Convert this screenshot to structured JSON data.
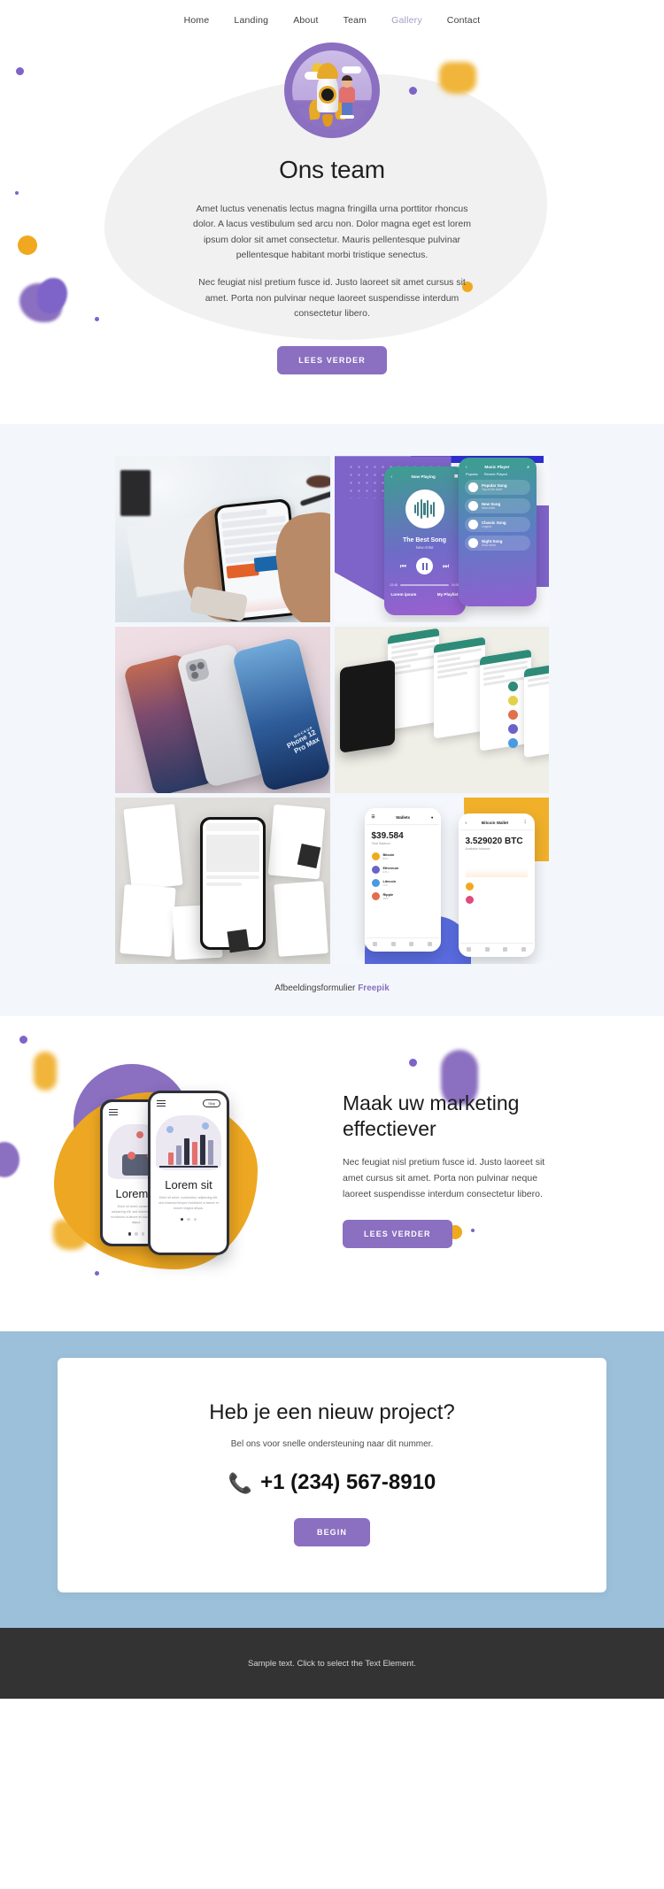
{
  "nav": {
    "items": [
      {
        "label": "Home",
        "active": false
      },
      {
        "label": "Landing",
        "active": false
      },
      {
        "label": "About",
        "active": false
      },
      {
        "label": "Team",
        "active": false
      },
      {
        "label": "Gallery",
        "active": true
      },
      {
        "label": "Contact",
        "active": false
      }
    ]
  },
  "hero": {
    "illustration_icon": "rocket-astronaut-icon",
    "title": "Ons team",
    "paragraph1": "Amet luctus venenatis lectus magna fringilla urna porttitor rhoncus dolor. A lacus vestibulum sed arcu non. Dolor magna eget est lorem ipsum dolor sit amet consectetur. Mauris pellentesque pulvinar pellentesque habitant morbi tristique senectus.",
    "paragraph2": "Nec feugiat nisl pretium fusce id. Justo laoreet sit amet cursus sit amet. Porta non pulvinar neque laoreet suspendisse interdum consectetur libero.",
    "cta_label": "LEES VERDER"
  },
  "gallery": {
    "items": [
      {
        "name": "hand-holding-phone-trading-app"
      },
      {
        "name": "music-player-app-mockup"
      },
      {
        "name": "phones-on-pink-surface"
      },
      {
        "name": "chat-app-screens-mockup"
      },
      {
        "name": "ui-screens-on-grey-desk"
      },
      {
        "name": "crypto-wallet-app-mockup"
      }
    ],
    "caption_text": "Afbeeldingsformulier",
    "caption_link": "Freepik",
    "music_mockup": {
      "now_playing": "Now Playing",
      "song_title": "The Best Song",
      "artist": "New Artist",
      "time_current": "02:48",
      "time_total": "04:09",
      "link_left": "Lorem ipsum",
      "link_right": "My Playlist",
      "player_title": "Music Player",
      "tab_popular": "Popular",
      "tab_recent": "Recent Played",
      "list": [
        {
          "title": "Popular Song",
          "sub": "Top of the chart"
        },
        {
          "title": "New Song",
          "sub": "New Artist"
        },
        {
          "title": "Classic Song",
          "sub": "Legend"
        },
        {
          "title": "Night Song",
          "sub": "Slow Artist"
        }
      ]
    },
    "pink_mockup": {
      "label_top": "MOCKUP",
      "label_model": "Phone 12",
      "label_variant": "Pro Max"
    },
    "wallet_mockup": {
      "left_title": "Wallets",
      "left_amount": "$39.584",
      "left_caption": "Total Balance",
      "right_title": "Bitcoin Wallet",
      "right_amount": "3.529020 BTC",
      "right_caption": "Available balance",
      "rows": [
        {
          "title": "Bitcoin",
          "sub": "BTC"
        },
        {
          "title": "Ethereum",
          "sub": "ETH"
        },
        {
          "title": "Litecoin",
          "sub": "LTC"
        },
        {
          "title": "Ripple",
          "sub": "XRP"
        }
      ]
    }
  },
  "marketing": {
    "title": "Maak uw marketing effectiever",
    "paragraph": "Nec feugiat nisl pretium fusce id. Justo laoreet sit amet cursus sit amet. Porta non pulvinar neque laoreet suspendisse interdum consectetur libero.",
    "cta_label": "LEES VERDER",
    "phone_back": {
      "heading": "Lorem s",
      "body": "Dolor sit amet, consectetur adipiscing elit, sed eiusmod tempor incididunt ut labore et dolore magna aliqua."
    },
    "phone_front": {
      "skip_label": "Skip",
      "heading": "Lorem sit",
      "body": "Dolor sit amet, consectetur adipiscing elit, sed eiusmod tempor incididunt ut labore et dolore magna aliqua."
    }
  },
  "cta": {
    "title": "Heb je een nieuw project?",
    "subtitle": "Bel ons voor snelle ondersteuning naar dit nummer.",
    "phone_icon": "phone-icon",
    "phone": "+1 (234) 567-8910",
    "button_label": "BEGIN"
  },
  "footer": {
    "text": "Sample text. Click to select the Text Element."
  },
  "colors": {
    "accent_purple": "#8b6fc0",
    "accent_yellow": "#eda722",
    "cta_background": "#9cc0da",
    "footer_background": "#333333",
    "gallery_background": "#f3f7fb"
  }
}
